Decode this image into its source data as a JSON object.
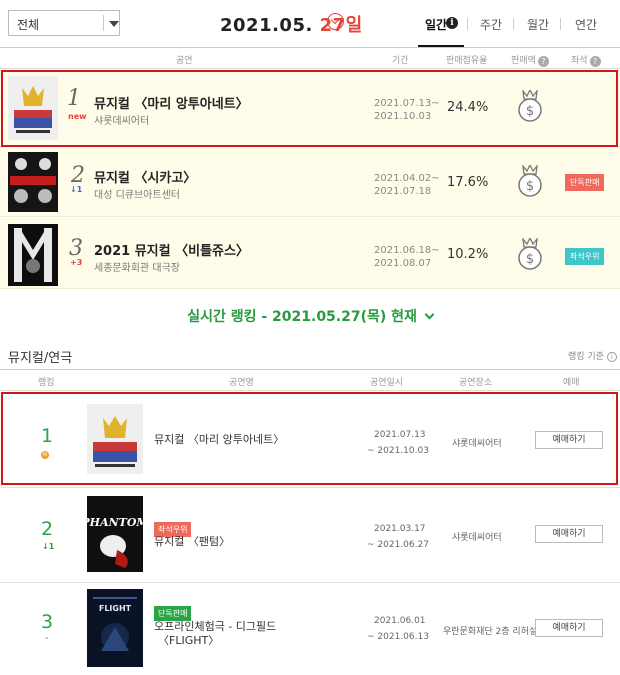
{
  "filter": {
    "selected": "전체"
  },
  "date": {
    "ym": "2021.05.",
    "day": "27일"
  },
  "period_tabs": [
    "일간",
    "주간",
    "월간",
    "연간"
  ],
  "top_header": {
    "show": "공연",
    "period": "기간",
    "share": "판매점유율",
    "sales": "판매액",
    "seats": "좌석"
  },
  "top_rows": [
    {
      "rank": "1",
      "delta": "new",
      "title": "뮤지컬 〈마리 앙투아네트〉",
      "venue": "샤롯데씨어터",
      "period1": "2021.07.13~",
      "period2": "2021.10.03",
      "share": "24.4%",
      "badge": ""
    },
    {
      "rank": "2",
      "delta": "↓1",
      "title": "뮤지컬 〈시카고〉",
      "venue": "대성 디큐브아트센터",
      "period1": "2021.04.02~",
      "period2": "2021.07.18",
      "share": "17.6%",
      "badge": "단독판매"
    },
    {
      "rank": "3",
      "delta": "+3",
      "title": "2021 뮤지컬 〈비틀쥬스〉",
      "venue": "세종문화회관 대극장",
      "period1": "2021.06.18~",
      "period2": "2021.08.07",
      "share": "10.2%",
      "badge": "좌석우위"
    }
  ],
  "realtime": {
    "label": "실시간 랭킹 - 2021.05.27(목) 현재"
  },
  "section": {
    "title": "뮤지컬/연극",
    "basis": "랭킹 기준"
  },
  "rank_header": {
    "rank": "랭킹",
    "show": "공연명",
    "date": "공연일시",
    "venue": "공연장소",
    "book": "예매"
  },
  "rank_rows": [
    {
      "rank": "1",
      "delta": "N",
      "tag": "",
      "title": "뮤지컬 〈마리 앙투아네트〉",
      "title2": "",
      "d1": "2021.07.13",
      "d2": "~ 2021.10.03",
      "venue": "샤롯데씨어터",
      "btn": "예매하기"
    },
    {
      "rank": "2",
      "delta": "↓1",
      "tag": "좌석우위",
      "title": "뮤지컬 〈팬텀〉",
      "title2": "",
      "d1": "2021.03.17",
      "d2": "~ 2021.06.27",
      "venue": "샤롯데씨어터",
      "btn": "예매하기"
    },
    {
      "rank": "3",
      "delta": "-",
      "tag": "단독판매",
      "title": "오프라인체험극 - 디그필드",
      "title2": "〈FLIGHT〉",
      "d1": "2021.06.01",
      "d2": "~ 2021.06.13",
      "venue": "우란문화재단 2층 리허설룸",
      "btn": "예매하기"
    }
  ],
  "posters": {
    "p3_caption": "FLIGHT"
  },
  "colors": {
    "accent_red": "#e5473b",
    "highlight_border": "#d1161c",
    "rank_green": "#2aa447",
    "tag_red": "#ef6a5c",
    "tag_teal": "#3ec6c9"
  }
}
